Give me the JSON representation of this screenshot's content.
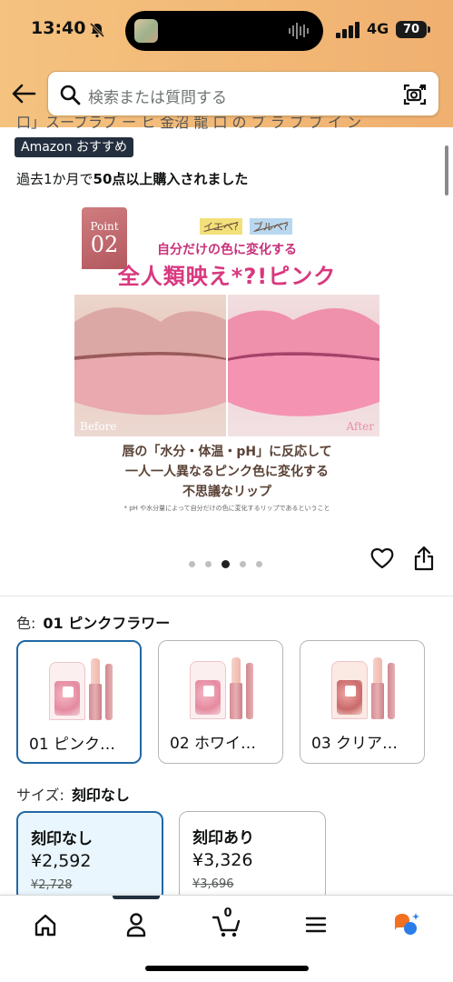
{
  "status_bar": {
    "time": "13:40",
    "network": "4G",
    "battery": "70"
  },
  "search": {
    "placeholder": "検索または質問する"
  },
  "product": {
    "title_fragment": "口」スーブラブ ー ヒ 金沼 龍 口 の ブ ラ ブ ブ イ ン",
    "badge_brand": "Amazon",
    "badge_text": "おすすめ",
    "purchase_prefix": "過去1か月で",
    "purchase_bold": "50点以上購入されました"
  },
  "promo_image": {
    "point_label": "Point",
    "point_number": "02",
    "tag_yellow": "イエベ?",
    "tag_blue": "ブルベ?",
    "subtitle": "自分だけの色に変化する",
    "headline": "全人類映え*?!ピンク",
    "before_label": "Before",
    "after_label": "After",
    "desc_line1": "唇の「水分・体温・pH」に反応して",
    "desc_line2": "一人一人異なるピンク色に変化する",
    "desc_line3": "不思議なリップ",
    "footnote": "* pH や水分量によって自分だけの色に変化するリップであるということ"
  },
  "carousel": {
    "count": 5,
    "active_index": 2
  },
  "color": {
    "label": "色:",
    "value": "01 ピンクフラワー",
    "options": [
      {
        "name": "01 ピンク…",
        "selected": true
      },
      {
        "name": "02 ホワイ…",
        "selected": false
      },
      {
        "name": "03 クリア…",
        "selected": false
      }
    ]
  },
  "size": {
    "label": "サイズ:",
    "value": "刻印なし",
    "options": [
      {
        "name": "刻印なし",
        "price": "¥2,592",
        "old_price": "¥2,728",
        "selected": true
      },
      {
        "name": "刻印あり",
        "price": "¥3,326",
        "old_price": "¥3,696",
        "selected": false
      }
    ]
  },
  "nav": {
    "cart_count": "0"
  }
}
